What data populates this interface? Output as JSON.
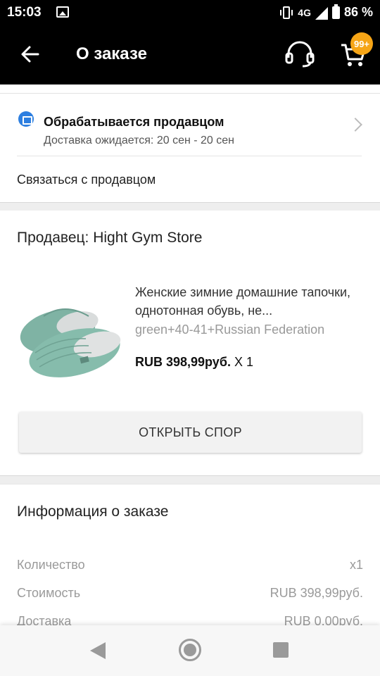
{
  "status_bar": {
    "time": "15:03",
    "network": "4G",
    "battery": "86 %"
  },
  "toolbar": {
    "title": "О заказе",
    "cart_badge": "99+"
  },
  "order_status": {
    "title": "Обрабатывается продавцом",
    "delivery": "Доставка ожидается: 20 сен - 20 сен",
    "contact_seller": "Связаться с продавцом"
  },
  "seller": {
    "name": "Продавец: Hight Gym Store"
  },
  "product": {
    "title": "Женские зимние домашние тапочки, однотонная обувь, не...",
    "variant": "green+40-41+Russian Federation",
    "price": "RUB 398,99руб.",
    "quantity": " X 1"
  },
  "dispute_button": "ОТКРЫТЬ СПОР",
  "order_info": {
    "title": "Информация о заказе",
    "rows": [
      {
        "label": "Количество",
        "value": "x1"
      },
      {
        "label": "Стоимость",
        "value": "RUB 398,99руб."
      },
      {
        "label": "Доставка",
        "value": "RUB 0,00руб."
      }
    ]
  },
  "icons": {
    "back": "arrow-left-icon",
    "support": "headset-icon",
    "cart": "cart-icon",
    "status": "store-icon"
  },
  "colors": {
    "header_bg": "#000000",
    "badge": "#f6a516",
    "status_icon": "#2d7fe0"
  }
}
